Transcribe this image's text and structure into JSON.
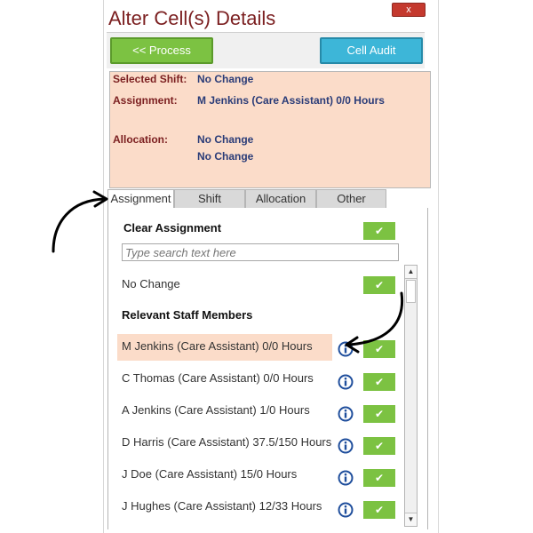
{
  "window": {
    "title": "Alter Cell(s) Details",
    "close_label": "x"
  },
  "toolbar": {
    "process_label": "<< Process",
    "audit_label": "Cell Audit"
  },
  "details": {
    "selected_shift_label": "Selected Shift:",
    "selected_shift_value": "No Change",
    "assignment_label": "Assignment:",
    "assignment_value": "M Jenkins (Care Assistant) 0/0 Hours",
    "allocation_label": "Allocation:",
    "allocation_values": [
      "No Change",
      "No Change"
    ]
  },
  "tabs": [
    {
      "label": "Assignment",
      "active": true
    },
    {
      "label": "Shift",
      "active": false
    },
    {
      "label": "Allocation",
      "active": false
    },
    {
      "label": "Other",
      "active": false
    }
  ],
  "assignment_tab": {
    "clear_label": "Clear Assignment",
    "search_placeholder": "Type search text here",
    "no_change_label": "No Change",
    "section_heading": "Relevant Staff Members",
    "staff": [
      {
        "name": "M Jenkins (Care Assistant) 0/0 Hours",
        "selected": true
      },
      {
        "name": "C Thomas (Care Assistant) 0/0 Hours",
        "selected": false
      },
      {
        "name": "A Jenkins (Care Assistant) 1/0 Hours",
        "selected": false
      },
      {
        "name": "D Harris (Care Assistant) 37.5/150 Hours",
        "selected": false
      },
      {
        "name": "J Doe (Care Assistant) 15/0 Hours",
        "selected": false
      },
      {
        "name": "J Hughes (Care Assistant) 12/33 Hours",
        "selected": false
      }
    ]
  },
  "icons": {
    "check": "check-icon",
    "info": "info-icon",
    "annotation_arrow": "curved-arrow-icon"
  },
  "colors": {
    "title": "#7b1f20",
    "value_text": "#2a3c78",
    "details_bg": "#fbdcc9",
    "process_button": "#7cc242",
    "audit_button": "#3db6d8",
    "check_button": "#7cc242",
    "close_button": "#c4392e",
    "info_icon": "#1f4e9c"
  }
}
